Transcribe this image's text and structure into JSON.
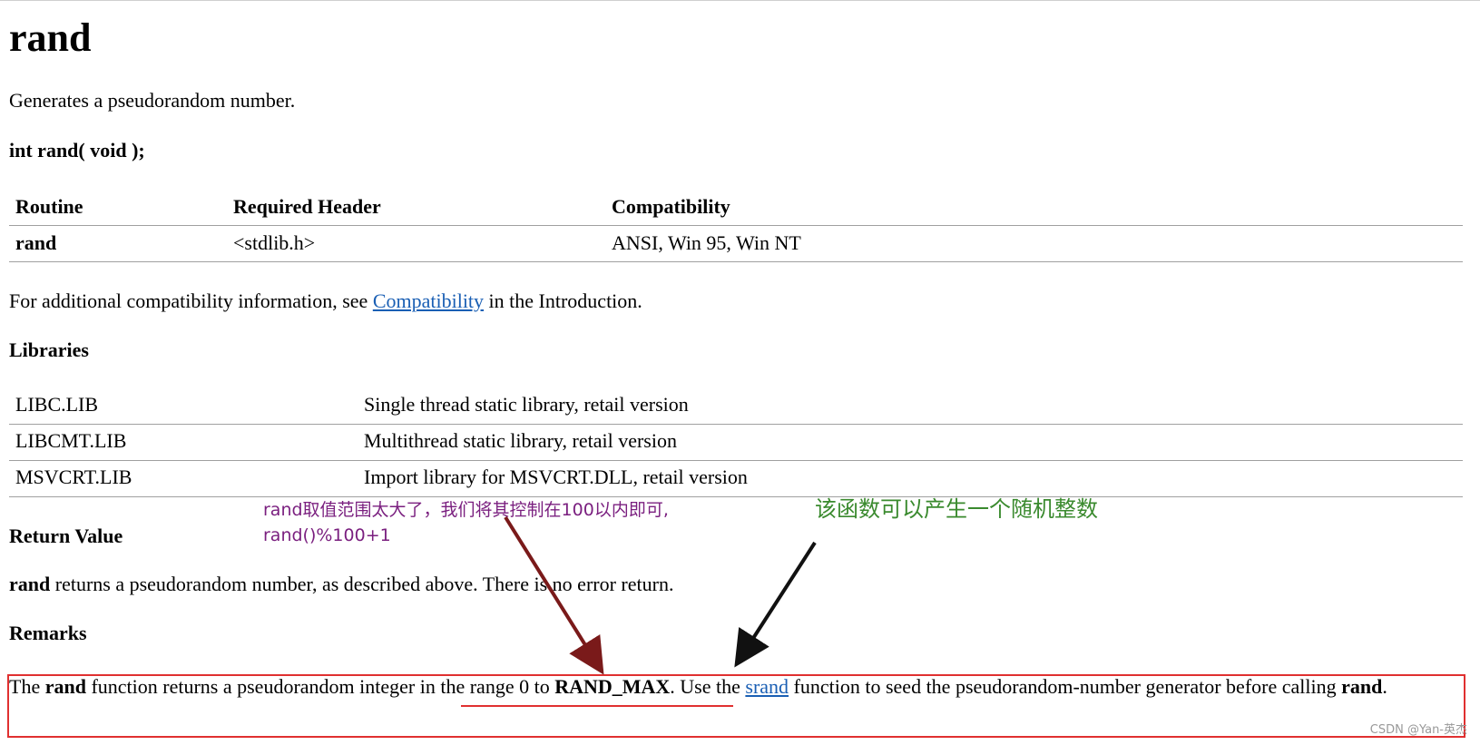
{
  "doc": {
    "title": "rand",
    "description": "Generates a pseudorandom number.",
    "prototype": "int rand( void );"
  },
  "routine_table": {
    "headers": [
      "Routine",
      "Required Header",
      "Compatibility"
    ],
    "row": {
      "routine": "rand",
      "header": "<stdlib.h>",
      "compatibility": "ANSI, Win 95, Win NT"
    }
  },
  "compat_note": {
    "before": "For additional compatibility information, see ",
    "link": "Compatibility",
    "after": " in the Introduction."
  },
  "libraries": {
    "heading": "Libraries",
    "rows": [
      {
        "lib": "LIBC.LIB",
        "desc": "Single thread static library, retail version"
      },
      {
        "lib": "LIBCMT.LIB",
        "desc": "Multithread static library, retail version"
      },
      {
        "lib": "MSVCRT.LIB",
        "desc": "Import library for MSVCRT.DLL, retail version"
      }
    ]
  },
  "return_value": {
    "heading": "Return Value",
    "bold": "rand",
    "text": " returns a pseudorandom number, as described above. There is no error return."
  },
  "remarks": {
    "heading": "Remarks",
    "t1": "The ",
    "b1": "rand",
    "t2": " function returns a pseudorandom integer in the range 0 to ",
    "b2": "RAND_MAX",
    "t3": ". Use the ",
    "link": "srand",
    "t4": " function to seed the pseudorandom-number generator before calling ",
    "b3": "rand",
    "t5": "."
  },
  "annotations": {
    "purple_line1": "rand取值范围太大了，我们将其控制在100以内即可,",
    "purple_line2": "rand()%100+1",
    "green": "该函数可以产生一个随机整数",
    "colors": {
      "purple": "#7a1f7f",
      "green": "#3a8a2e",
      "red": "#e03030",
      "link": "#1a5fb4"
    }
  },
  "watermark": "CSDN @Yan-英杰"
}
